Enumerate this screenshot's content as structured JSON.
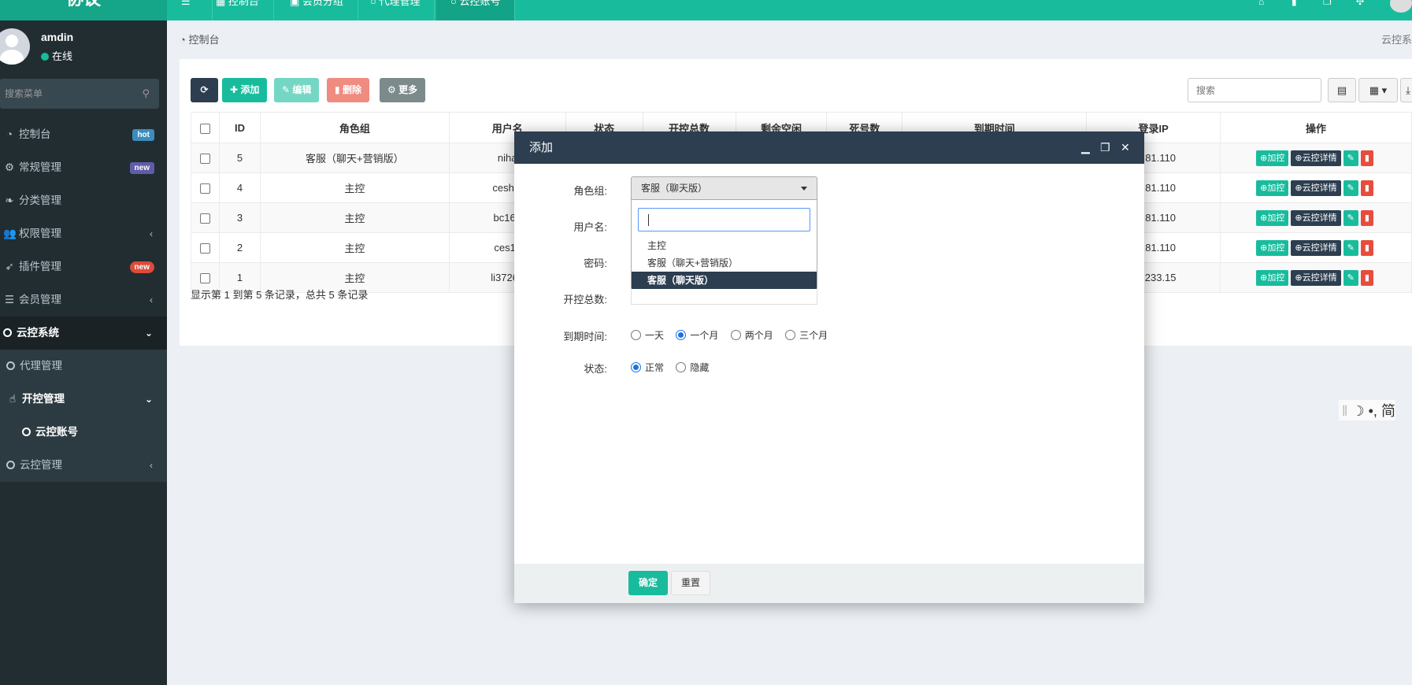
{
  "app": {
    "logo": "协议"
  },
  "topnav": {
    "tabs": [
      {
        "label": "控制台"
      },
      {
        "label": "会员分组"
      },
      {
        "label": "代理管理"
      },
      {
        "label": "云控账号"
      }
    ]
  },
  "sidebar": {
    "user": {
      "name": "amdin",
      "status": "在线"
    },
    "search_placeholder": "搜索菜单",
    "items": [
      {
        "label": "控制台",
        "badge": "hot",
        "badge_color": "#3c8dbc"
      },
      {
        "label": "常规管理",
        "badge": "new",
        "badge_color": "#605ca8"
      },
      {
        "label": "分类管理"
      },
      {
        "label": "权限管理"
      },
      {
        "label": "插件管理",
        "badge": "new",
        "badge_color": "#dd4b39"
      },
      {
        "label": "会员管理"
      },
      {
        "label": "云控系统"
      },
      {
        "label": "代理管理"
      },
      {
        "label": "开控管理"
      },
      {
        "label": "云控账号"
      },
      {
        "label": "云控管理"
      }
    ]
  },
  "breadcrumb": {
    "label": "控制台",
    "right": "云控系"
  },
  "toolbar": {
    "add": "添加",
    "edit": "编辑",
    "delete": "删除",
    "more": "更多",
    "search_placeholder": "搜索"
  },
  "table": {
    "headers": [
      "ID",
      "角色组",
      "用户名",
      "状态",
      "开控总数",
      "剩余空闲",
      "死号数",
      "到期时间",
      "登录IP",
      "操作"
    ],
    "rows": [
      {
        "id": "5",
        "role": "客服（聊天+营销版）",
        "user": "niha",
        "ip": "20.81.110"
      },
      {
        "id": "4",
        "role": "主控",
        "user": "ceshi0",
        "ip": "20.81.110"
      },
      {
        "id": "3",
        "role": "主控",
        "user": "bc168",
        "ip": "20.81.110"
      },
      {
        "id": "2",
        "role": "主控",
        "user": "ces11",
        "ip": "20.81.110"
      },
      {
        "id": "1",
        "role": "主控",
        "user": "li37264",
        "ip": "94.233.15"
      }
    ],
    "actions": {
      "add_control": "加控",
      "detail": "云控详情"
    },
    "summary": "显示第 1 到第 5 条记录，总共 5 条记录"
  },
  "modal": {
    "title": "添加",
    "fields": {
      "role_label": "角色组:",
      "role_value": "客服（聊天版）",
      "username_label": "用户名:",
      "password_label": "密码:",
      "total_label": "开控总数:",
      "expire_label": "到期时间:",
      "status_label": "状态:"
    },
    "role_options": [
      "主控",
      "客服（聊天+营销版）",
      "客服（聊天版）"
    ],
    "expire_options": [
      "一天",
      "一个月",
      "两个月",
      "三个月"
    ],
    "expire_selected": 1,
    "status_options": [
      "正常",
      "隐藏"
    ],
    "status_selected": 0,
    "confirm": "确定",
    "reset": "重置"
  }
}
